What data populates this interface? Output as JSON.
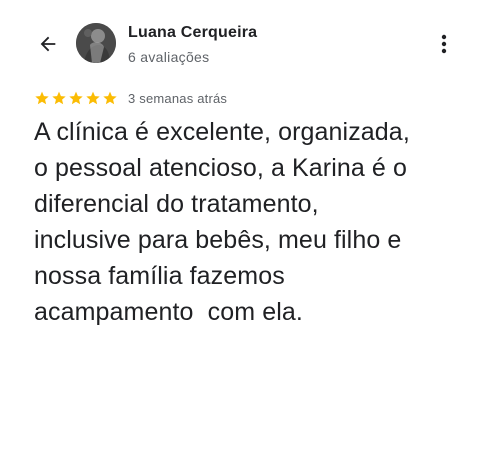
{
  "header": {
    "back_icon": "arrow-back-icon",
    "more_icon": "more-vert-icon",
    "author_name": "Luana Cerqueira",
    "review_count": "6 avaliações"
  },
  "review": {
    "rating": 5,
    "rating_max": 5,
    "star_color": "#fbbc04",
    "timestamp": "3 semanas atrás",
    "text_lines": [
      "A clínica é excelente, organizada,",
      "o pessoal atencioso, a Karina é o",
      "diferencial do tratamento,",
      "inclusive para bebês, meu filho e",
      "nossa família fazemos",
      "acampamento  com ela."
    ]
  }
}
